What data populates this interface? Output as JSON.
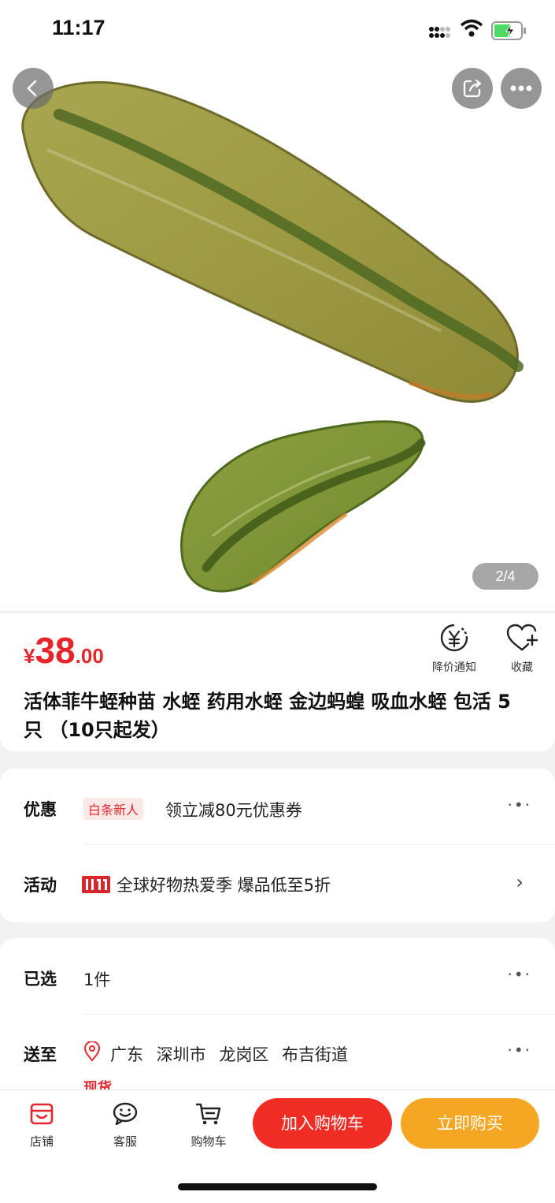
{
  "status_bar": {
    "time": "11:17"
  },
  "gallery": {
    "counter": "2/4"
  },
  "product": {
    "price_currency": "¥",
    "price_integer": "38",
    "price_decimal": ".00",
    "title": "活体菲牛蛭种苗 水蛭 药用水蛭 金边蚂蝗 吸血水蛭 包活 5只 （10只起发）",
    "notify_label": "降价通知",
    "favorite_label": "收藏"
  },
  "promotions": {
    "discount_label": "优惠",
    "discount_badge": "白条新人",
    "discount_text": "领立减80元优惠券",
    "activity_label": "活动",
    "activity_text": "全球好物热爱季 爆品低至5折"
  },
  "options": {
    "selected_label": "已选",
    "selected_value": "1件",
    "ship_label": "送至",
    "ship_address": "广东 深圳市 龙岗区 布吉街道",
    "stock_status": "现货"
  },
  "bottom_bar": {
    "store_label": "店铺",
    "service_label": "客服",
    "cart_label": "购物车",
    "add_to_cart": "加入购物车",
    "buy_now": "立即购买"
  },
  "colors": {
    "price_red": "#e6262d",
    "cart_button": "#ef2d24",
    "buy_button": "#f5a623"
  },
  "icons": [
    "back-arrow-icon",
    "share-icon",
    "more-icon",
    "price-alert-icon",
    "heart-plus-icon",
    "store-icon",
    "customer-service-icon",
    "shopping-cart-icon",
    "location-pin-icon",
    "double-11-icon"
  ]
}
